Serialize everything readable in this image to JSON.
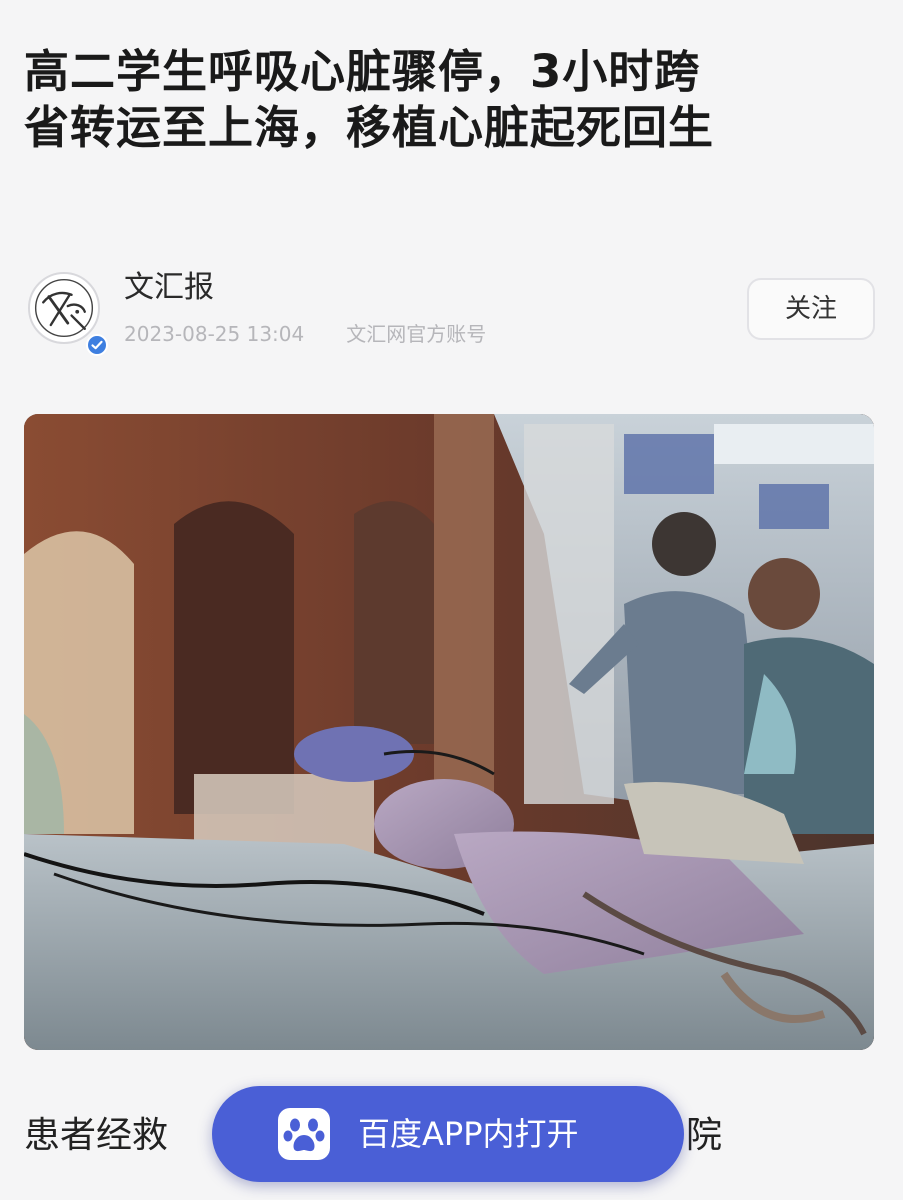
{
  "article": {
    "headline_line1": "高二学生呼吸心脏骤停，3小时跨",
    "headline_line2": "省转运至上海，移植心脏起死回生",
    "body_start": "患者经救",
    "body_tail": "院"
  },
  "author": {
    "name": "文汇报",
    "datetime": "2023-08-25 13:04",
    "account_type": "文汇网官方账号",
    "avatar_logo_text": "文汇",
    "follow_label": "关注"
  },
  "banner": {
    "label": "百度APP内打开",
    "icon": "baidu-paw-icon"
  },
  "colors": {
    "banner": "#4a5fd6",
    "verify_badge": "#3e7fe0",
    "background": "#f5f5f6"
  }
}
